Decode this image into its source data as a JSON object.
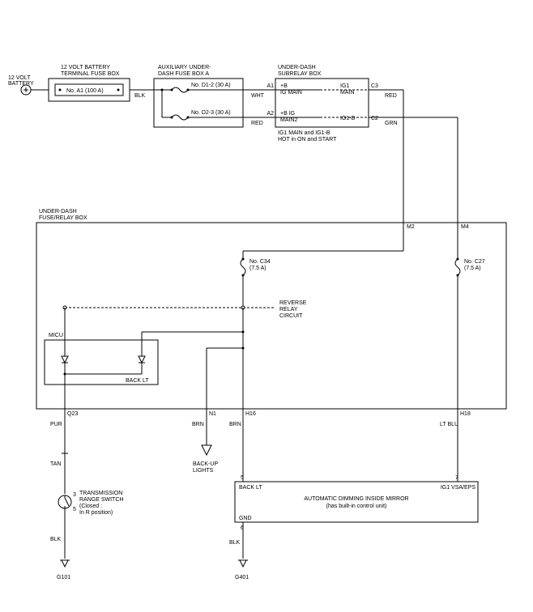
{
  "source": {
    "label1": "12 VOLT",
    "label2": "BATTERY"
  },
  "batteryBox": {
    "title1": "12 VOLT BATTERY",
    "title2": "TERMINAL FUSE BOX",
    "fuse": "No. A1 (100 A)"
  },
  "wireColors": {
    "blk1": "BLK",
    "wht": "WHT",
    "red1": "RED",
    "red2": "RED",
    "grn": "GRN",
    "pur": "PUR",
    "tan": "TAN",
    "brn": "BRN",
    "brn2": "BRN",
    "ltblu": "LT BLU",
    "blk2": "BLK",
    "blk3": "BLK"
  },
  "auxBox": {
    "title1": "AUXILIARY UNDER-",
    "title2": "DASH FUSE BOX A",
    "fuse1": "No. D1-2 (30 A)",
    "fuse2": "No. D2-3 (30 A)"
  },
  "subrelayBox": {
    "title1": "UNDER-DASH",
    "title2": "SUBRELAY BOX",
    "pinA1": "A1",
    "pinA2": "A2",
    "labB_IGMAIN1": "+B",
    "labB_IGMAIN1b": "IG MAIN",
    "labB_IGMAIN2": "+B IG",
    "labB_IGMAIN2b": "MAIN2",
    "pinC3": "C3",
    "pinC2": "C2",
    "labIG1MAIN": "IG1",
    "labIG1MAINb": "MAIN",
    "labIG1B": "IG1-B",
    "note1": "IG1 MAIN and IG1-B",
    "note2": "HOT in ON and START"
  },
  "fuseRelayBox": {
    "title1": "UNDER-DASH",
    "title2": "FUSE/RELAY BOX",
    "pinM2": "M2",
    "pinM4": "M4",
    "fuseC34": "No. C34",
    "fuseC34amp": "(7.5 A)",
    "fuseC27": "No. C27",
    "fuseC27amp": "(7.5 A)",
    "revRelay1": "REVERSE",
    "revRelay2": "RELAY",
    "revRelay3": "CIRCUIT",
    "micu": "MICU",
    "backlt": "BACK LT",
    "pinQ23": "Q23",
    "pinN1": "N1",
    "pinH16": "H16",
    "pinH18": "H18"
  },
  "transSwitch": {
    "pin3": "3",
    "pin5": "5",
    "label1": "TRANSMISSION",
    "label2": "RANGE SWITCH",
    "label3": "(Closed :",
    "label4": "In R position)"
  },
  "backupLights": {
    "label1": "BACK-UP",
    "label2": "LIGHTS"
  },
  "mirror": {
    "pin5": "5",
    "pin7": "7",
    "pin6": "6",
    "lab5": "BACK LT",
    "lab7": "IG1 VSA/EPS",
    "title1": "AUTOMATIC DIMMING INSIDE MIRROR",
    "title2": "(has built-in control unit)",
    "gnd": "GND"
  },
  "grounds": {
    "g101": "G101",
    "g401": "G401"
  }
}
